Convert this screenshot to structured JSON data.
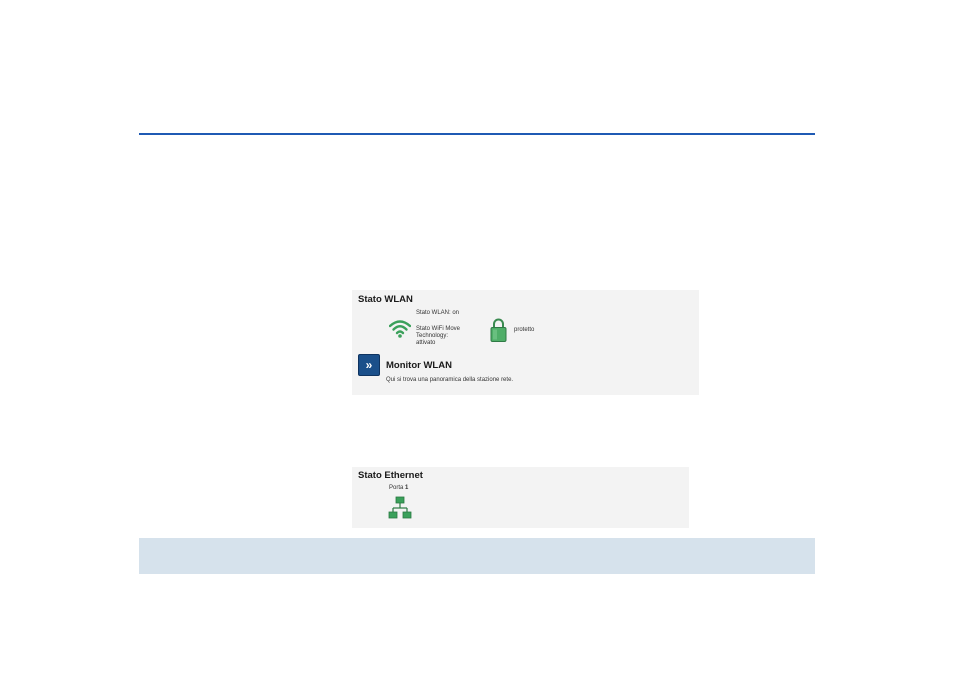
{
  "wlan_panel": {
    "title": "Stato WLAN",
    "status_wlan": "Stato WLAN: on",
    "status_move_line1": "Stato WiFi Move",
    "status_move_line2": "Technology:",
    "status_move_line3": "attivato",
    "security_status": "protetto",
    "monitor_button_glyph": "»",
    "monitor_title": "Monitor WLAN",
    "monitor_description": "Qui si trova una panoramica della stazione rete.",
    "icons": [
      "wifi-icon",
      "lock-icon",
      "double-chevron-right-icon"
    ]
  },
  "ethernet_panel": {
    "title": "Stato Ethernet",
    "port_prefix": "Porta ",
    "port_number": "1",
    "icons": [
      "network-icon"
    ]
  },
  "colors": {
    "rule": "#1f5ab4",
    "panel_bg": "#f3f3f3",
    "footer_bg": "#d6e2ec",
    "icon_green": "#3aa05a",
    "button_blue": "#1a4f8a"
  }
}
